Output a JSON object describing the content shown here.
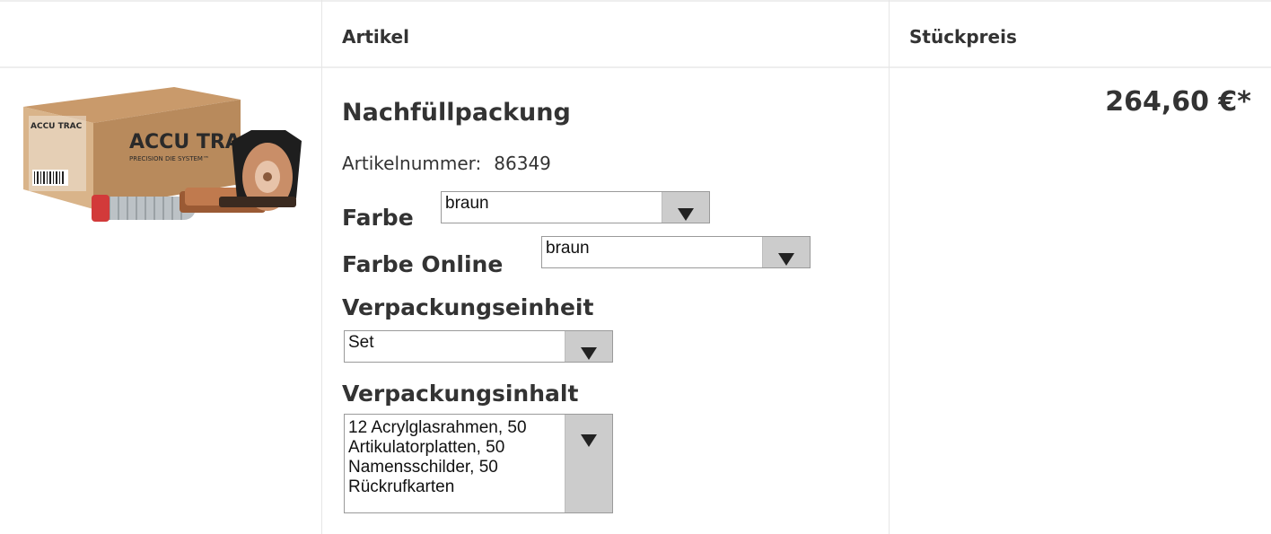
{
  "table": {
    "headers": {
      "article": "Artikel",
      "unit_price": "Stückpreis"
    }
  },
  "product": {
    "image_alt": "ACCU TRAC PRECISION DIE SYSTEM",
    "brand_text": "ACCU TRAC",
    "name": "Nachfüllpackung",
    "article_number_label": "Artikelnummer:",
    "article_number": "86349",
    "price": "264,60 €*",
    "options": {
      "farbe": {
        "label": "Farbe",
        "value": "braun"
      },
      "farbe_online": {
        "label": "Farbe Online",
        "value": "braun"
      },
      "verpackungseinheit": {
        "label": "Verpackungseinheit",
        "value": "Set"
      },
      "verpackungsinhalt": {
        "label": "Verpackungsinhalt",
        "value_lines": [
          "12 Acrylglasrahmen, 50",
          "Artikulatorplatten, 50",
          "Namensschilder, 50",
          "Rückrufkarten"
        ]
      }
    }
  },
  "colors": {
    "box": "#b88a5c",
    "box_dark": "#8c6642",
    "copper": "#c07a4e",
    "select_button": "#cccccc"
  },
  "icons": {
    "dropdown": "triangle-down-icon"
  }
}
